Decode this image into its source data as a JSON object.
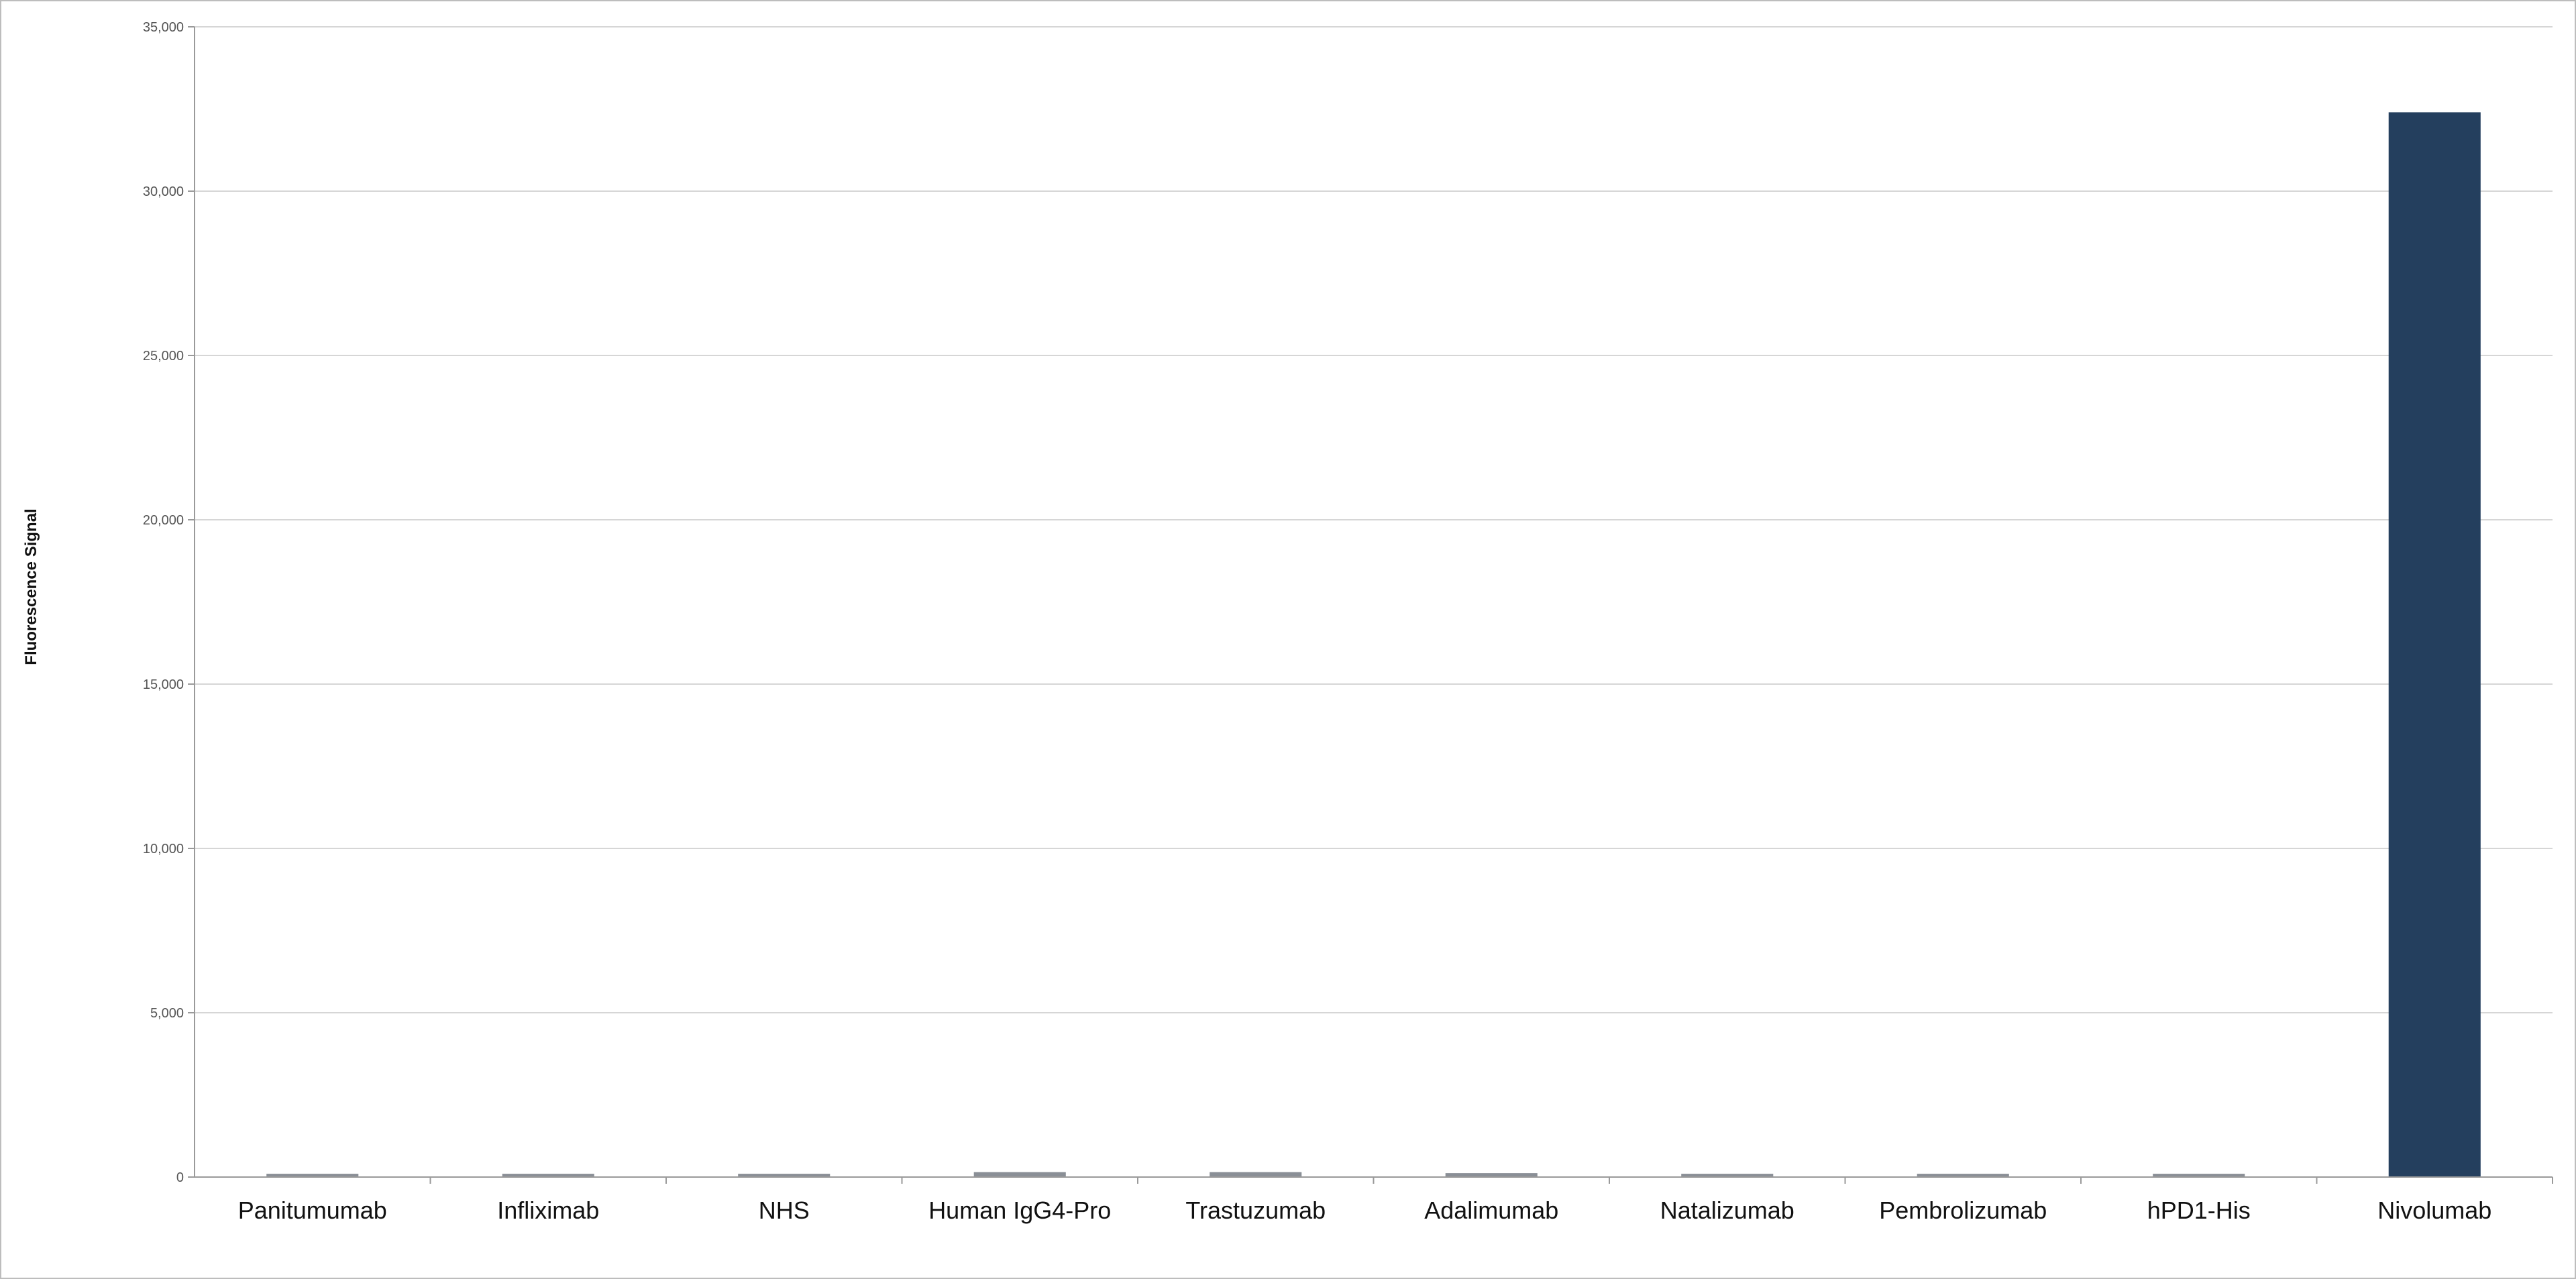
{
  "chart_data": {
    "type": "bar",
    "title": "",
    "xlabel": "",
    "ylabel": "Fluorescence Signal",
    "ylim": [
      0,
      35000
    ],
    "yticks": [
      0,
      5000,
      10000,
      15000,
      20000,
      25000,
      30000,
      35000
    ],
    "ytick_labels": [
      "0",
      "5,000",
      "10,000",
      "15,000",
      "20,000",
      "25,000",
      "30,000",
      "35,000"
    ],
    "grid": true,
    "legend": "none",
    "categories": [
      "Panitumumab",
      "Infliximab",
      "NHS",
      "Human IgG4-Pro",
      "Trastuzumab",
      "Adalimumab",
      "Natalizumab",
      "Pembrolizumab",
      "hPD1-His",
      "Nivolumab"
    ],
    "values": [
      100,
      100,
      100,
      150,
      150,
      120,
      100,
      100,
      100,
      32400
    ],
    "bar_colors": [
      "#8a8f96",
      "#8a8f96",
      "#8a8f96",
      "#8a8f96",
      "#8a8f96",
      "#8a8f96",
      "#8a8f96",
      "#8a8f96",
      "#8a8f96",
      "#243f5e"
    ]
  }
}
